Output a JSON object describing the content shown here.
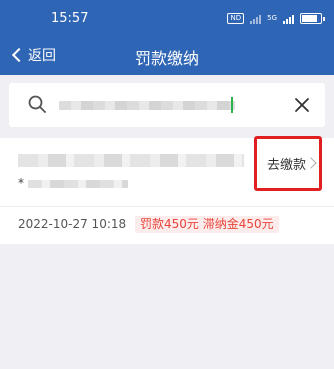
{
  "status_bar": {
    "time": "15:57",
    "nd_label": "ND",
    "gen_label": "5G"
  },
  "nav": {
    "back_label": "返回",
    "title": "罚款缴纳"
  },
  "search": {
    "value": "",
    "placeholder": ""
  },
  "record": {
    "id_prefix": "*",
    "date": "2022-10-27 10:18",
    "fee_text": "罚款450元 滞纳金450元",
    "action_label": "去缴款"
  },
  "colors": {
    "header": "#2e65b4",
    "highlight_border": "#e02020",
    "fee_text": "#e8443a",
    "fee_bg": "#fdecec"
  }
}
